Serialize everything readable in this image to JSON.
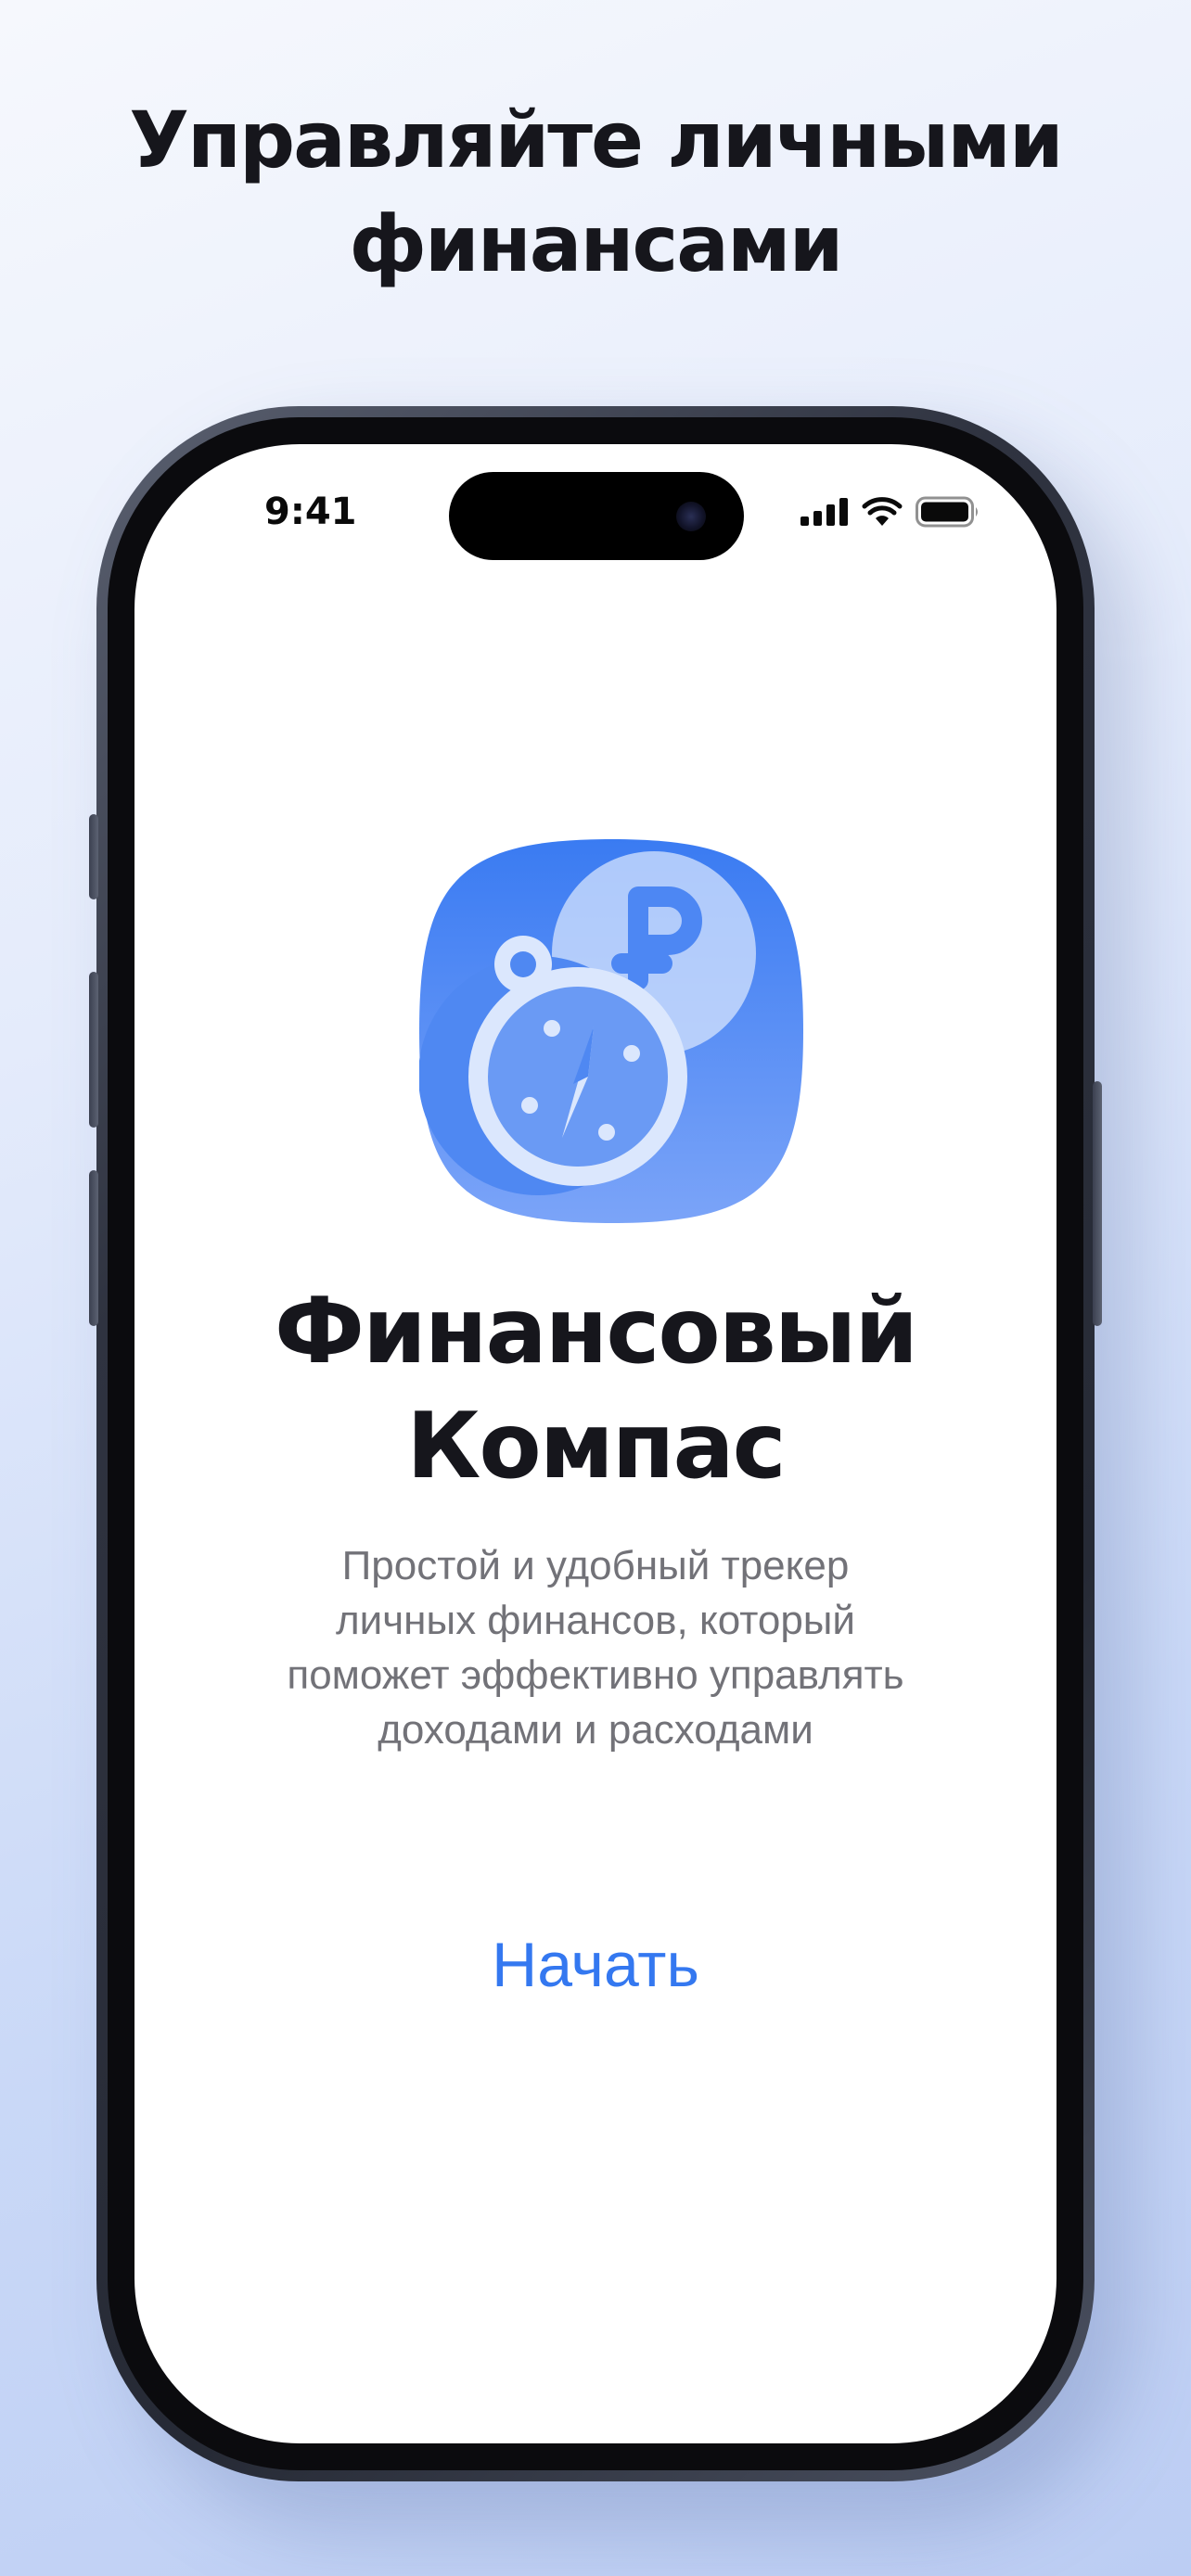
{
  "headline": {
    "line1": "Управляйте личными",
    "line2": "финансами"
  },
  "status_bar": {
    "time": "9:41",
    "icons": [
      "cellular-signal-icon",
      "wifi-icon",
      "battery-icon"
    ]
  },
  "app": {
    "icon": "compass-ruble-app-icon",
    "name_line1": "Финансовый",
    "name_line2": "Компас",
    "description_lines": [
      "Простой и удобный трекер",
      "личных финансов, который",
      "поможет эффективно управлять",
      "доходами и расходами"
    ]
  },
  "actions": {
    "start_label": "Начать"
  },
  "colors": {
    "accent": "#3478F0",
    "icon_gradient_top": "#3A7BF2",
    "icon_gradient_bottom": "#7BA4F8",
    "headline_text": "#16161C",
    "secondary_text": "#727278"
  }
}
